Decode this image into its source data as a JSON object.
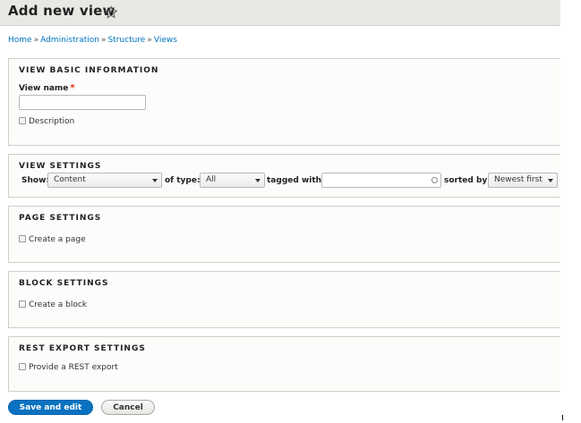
{
  "header": {
    "title": "Add new view",
    "favorite_icon": "star-icon"
  },
  "breadcrumb": [
    "Home",
    "Administration",
    "Structure",
    "Views"
  ],
  "breadcrumb_separator": "»",
  "basic_info": {
    "legend": "VIEW BASIC INFORMATION",
    "view_name_label": "View name",
    "required_marker": "*",
    "view_name_value": "",
    "description_label": "Description",
    "description_checked": false
  },
  "view_settings": {
    "legend": "VIEW SETTINGS",
    "show_label": "Show:",
    "show_value": "Content",
    "of_type_label": "of type:",
    "of_type_value": "All",
    "tagged_with_label": "tagged with:",
    "tagged_with_value": "",
    "sorted_by_label": "sorted by:",
    "sorted_by_value": "Newest first"
  },
  "page_settings": {
    "legend": "PAGE SETTINGS",
    "checkbox_label": "Create a page",
    "checked": false
  },
  "block_settings": {
    "legend": "BLOCK SETTINGS",
    "checkbox_label": "Create a block",
    "checked": false
  },
  "rest_settings": {
    "legend": "REST EXPORT SETTINGS",
    "checkbox_label": "Provide a REST export",
    "checked": false
  },
  "actions": {
    "save_label": "Save and edit",
    "cancel_label": "Cancel"
  },
  "colors": {
    "primary": "#0a72c0",
    "link": "#0074bd",
    "required": "#e62600",
    "header_bg": "#e8e8e4"
  }
}
